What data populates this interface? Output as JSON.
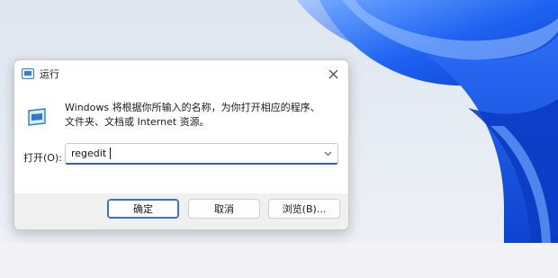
{
  "dialog": {
    "title": "运行",
    "title_icon": "run-icon",
    "close_icon": "close-icon",
    "description_line1": "Windows 将根据你所输入的名称，为你打开相应的程序、",
    "description_line2": "文件夹、文档或 Internet 资源。",
    "open_label": "打开(O):",
    "command_value": "regedit",
    "dropdown_icon": "chevron-down-icon",
    "buttons": {
      "ok": "确定",
      "cancel": "取消",
      "browse": "浏览(B)..."
    }
  },
  "colors": {
    "accent": "#2a63c4",
    "wallpaper_blue": "#1a5cf0"
  }
}
